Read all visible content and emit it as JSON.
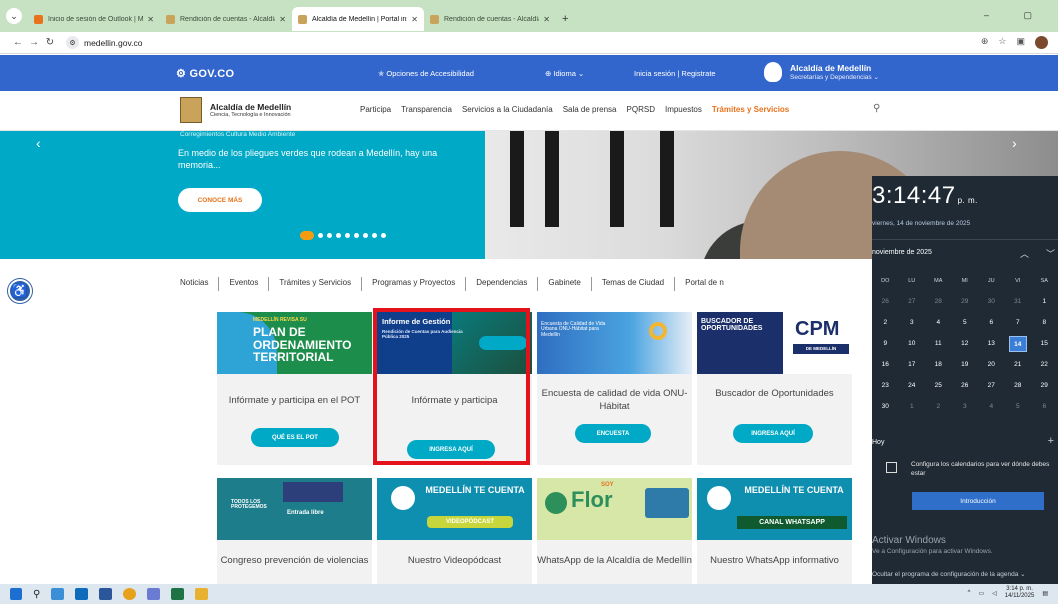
{
  "browser": {
    "tabs": [
      {
        "title": "Inicio de sesión de Outlook | Mi",
        "active": false,
        "favicon_color": "#e8731c"
      },
      {
        "title": "Rendición de cuentas - Alcaldía",
        "active": false,
        "favicon_color": "#c9a35a"
      },
      {
        "title": "Alcaldía de Medellín | Portal ins",
        "active": true,
        "favicon_color": "#c9a35a"
      },
      {
        "title": "Rendición de cuentas - Alcaldía",
        "active": false,
        "favicon_color": "#c9a35a"
      }
    ],
    "new_tab": "+",
    "url": "medellin.gov.co"
  },
  "govbar": {
    "logo": "GOV.CO",
    "accessibility": "Opciones de Accesibilidad",
    "language": "Idioma",
    "login": "Inicia sesión",
    "register": "Registrate",
    "alcaldia_title": "Alcaldía de Medellín",
    "alcaldia_sub": "Secretarías y Dependencias"
  },
  "site": {
    "brand_title": "Alcaldía de Medellín",
    "brand_sub": "Ciencia, Tecnología e Innovación",
    "nav": [
      "Participa",
      "Transparencia",
      "Servicios a la Ciudadanía",
      "Sala de prensa",
      "PQRSD",
      "Impuestos",
      "Trámites y Servicios"
    ]
  },
  "hero": {
    "crumbs": "Corregimientos     Cultura     Medio Ambiente",
    "text": "En medio de los pliegues verdes que rodean a Medellín, hay una memoria...",
    "cta": "CONOCE MÁS"
  },
  "section_tabs": [
    "Noticias",
    "Eventos",
    "Trámites y Servicios",
    "Programas y Proyectos",
    "Dependencias",
    "Gabinete",
    "Temas de Ciudad",
    "Portal de n"
  ],
  "cards_row1": [
    {
      "banner": "PLAN DE ORDENAMIENTO TERRITORIAL",
      "banner_top": "MEDELLÍN REVISA SU",
      "title": "Infórmate y participa en el POT",
      "button": "QUÉ ES EL POT"
    },
    {
      "banner": "Informe de Gestión",
      "banner_sub": "Rendición de Cuentas para Audiencia Pública 2025",
      "title": "Infórmate y participa",
      "button": "INGRESA AQUÍ"
    },
    {
      "banner": "Encuesta de Calidad de Vida Urbana ONU-Hábitat para Medellín",
      "title": "Encuesta de calidad de vida ONU-Hábitat",
      "button": "ENCUESTA"
    },
    {
      "banner": "BUSCADOR DE OPORTUNIDADES",
      "title": "Buscador de Oportunidades",
      "button": "INGRESA AQUÍ"
    }
  ],
  "cards_row2": [
    {
      "banner": "TODOS LOS PROTEGEMOS",
      "banner_sub": "Entrada libre",
      "title": "Congreso prevención de violencias"
    },
    {
      "banner": "MEDELLÍN TE CUENTA",
      "banner_sub": "VIDEOPÓDCAST",
      "title": "Nuestro Videopódcast"
    },
    {
      "banner": "Flor",
      "banner_top": "SOY",
      "title": "WhatsApp de la Alcaldía de Medellín"
    },
    {
      "banner": "MEDELLÍN TE CUENTA",
      "banner_sub": "CANAL WHATSAPP",
      "title": "Nuestro WhatsApp informativo"
    }
  ],
  "calendar": {
    "time": "3:14:47",
    "ampm": "p. m.",
    "date": "viernes, 14 de noviembre de 2025",
    "month": "noviembre de 2025",
    "weekdays": [
      "DO",
      "LU",
      "MA",
      "MI",
      "JU",
      "VI",
      "SA"
    ],
    "weeks": [
      [
        "26",
        "27",
        "28",
        "29",
        "30",
        "31",
        "1"
      ],
      [
        "2",
        "3",
        "4",
        "5",
        "6",
        "7",
        "8"
      ],
      [
        "9",
        "10",
        "11",
        "12",
        "13",
        "14",
        "15"
      ],
      [
        "16",
        "17",
        "18",
        "19",
        "20",
        "21",
        "22"
      ],
      [
        "23",
        "24",
        "25",
        "26",
        "27",
        "28",
        "29"
      ],
      [
        "30",
        "1",
        "2",
        "3",
        "4",
        "5",
        "6"
      ]
    ],
    "today": "14",
    "agenda_label": "Hoy",
    "config_text": "Configura los calendarios para ver dónde debes estar",
    "intro_button": "Introducción",
    "activate_title": "Activar Windows",
    "activate_sub": "Ve a Configuración para activar Windows.",
    "hide_agenda": "Ocultar el programa de configuración de la agenda"
  },
  "taskbar": {
    "clock_time": "3:14 p. m.",
    "clock_date": "14/11/2025"
  }
}
